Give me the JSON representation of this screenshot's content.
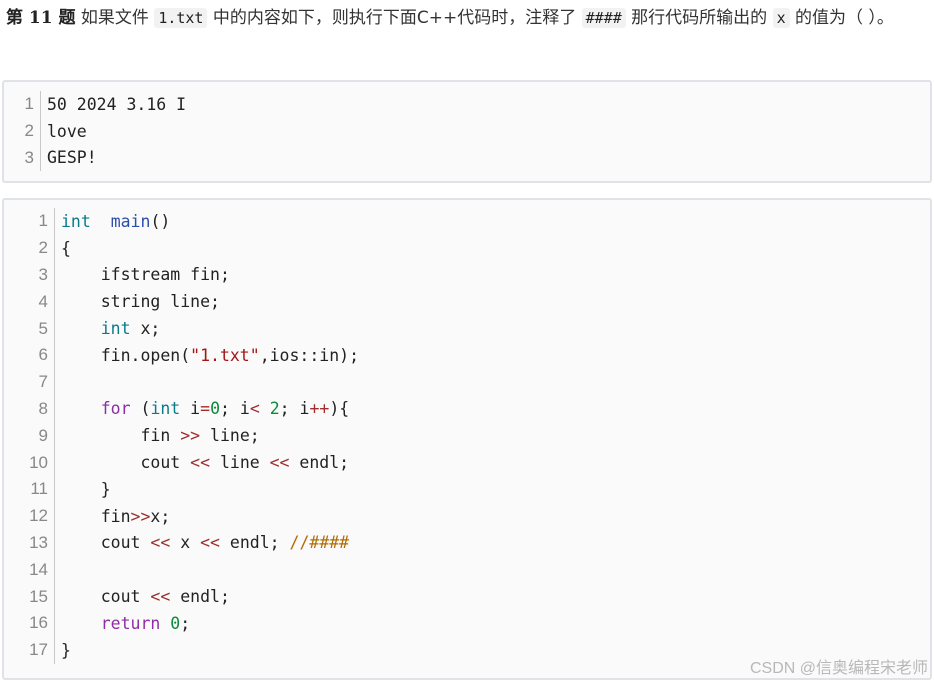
{
  "question": {
    "number_label": "第 11 题",
    "text_before": "如果文件",
    "filename": "1.txt",
    "text_middle": "中的内容如下，则执行下面C++代码时，注释了",
    "marker": "####",
    "text_after": "那行代码所输出的",
    "var": "x",
    "text_end": "的值为（ ）。"
  },
  "file_lines": [
    {
      "n": "1",
      "text": "50 2024 3.16 I"
    },
    {
      "n": "2",
      "text": "love"
    },
    {
      "n": "3",
      "text": "GESP!"
    }
  ],
  "code_lines": [
    {
      "n": "1",
      "tokens": [
        [
          "kw",
          "int"
        ],
        [
          "",
          "  "
        ],
        [
          "fn",
          "main"
        ],
        [
          "",
          "()"
        ]
      ]
    },
    {
      "n": "2",
      "tokens": [
        [
          "",
          "{"
        ]
      ]
    },
    {
      "n": "3",
      "tokens": [
        [
          "",
          "    ifstream fin;"
        ]
      ]
    },
    {
      "n": "4",
      "tokens": [
        [
          "",
          "    string line;"
        ]
      ]
    },
    {
      "n": "5",
      "tokens": [
        [
          "",
          "    "
        ],
        [
          "kw",
          "int"
        ],
        [
          "",
          " x;"
        ]
      ]
    },
    {
      "n": "6",
      "tokens": [
        [
          "",
          "    fin.open("
        ],
        [
          "str",
          "\"1.txt\""
        ],
        [
          "",
          ",ios::in);"
        ]
      ]
    },
    {
      "n": "7",
      "tokens": [
        [
          "",
          ""
        ]
      ]
    },
    {
      "n": "8",
      "tokens": [
        [
          "",
          "    "
        ],
        [
          "ctrl",
          "for"
        ],
        [
          "",
          " ("
        ],
        [
          "kw",
          "int"
        ],
        [
          "",
          " i"
        ],
        [
          "op",
          "="
        ],
        [
          "num",
          "0"
        ],
        [
          "",
          "; i"
        ],
        [
          "op",
          "<"
        ],
        [
          "",
          " "
        ],
        [
          "num",
          "2"
        ],
        [
          "",
          "; i"
        ],
        [
          "op",
          "++"
        ],
        [
          "",
          "){"
        ]
      ]
    },
    {
      "n": "9",
      "tokens": [
        [
          "",
          "        fin "
        ],
        [
          "op",
          ">>"
        ],
        [
          "",
          " line;"
        ]
      ]
    },
    {
      "n": "10",
      "tokens": [
        [
          "",
          "        cout "
        ],
        [
          "op",
          "<<"
        ],
        [
          "",
          " line "
        ],
        [
          "op",
          "<<"
        ],
        [
          "",
          " endl;"
        ]
      ]
    },
    {
      "n": "11",
      "tokens": [
        [
          "",
          "    }"
        ]
      ]
    },
    {
      "n": "12",
      "tokens": [
        [
          "",
          "    fin"
        ],
        [
          "op",
          ">>"
        ],
        [
          "",
          "x;"
        ]
      ]
    },
    {
      "n": "13",
      "tokens": [
        [
          "",
          "    cout "
        ],
        [
          "op",
          "<<"
        ],
        [
          "",
          " x "
        ],
        [
          "op",
          "<<"
        ],
        [
          "",
          " endl; "
        ],
        [
          "cmt",
          "//####"
        ]
      ]
    },
    {
      "n": "14",
      "tokens": [
        [
          "",
          ""
        ]
      ]
    },
    {
      "n": "15",
      "tokens": [
        [
          "",
          "    cout "
        ],
        [
          "op",
          "<<"
        ],
        [
          "",
          " endl;"
        ]
      ]
    },
    {
      "n": "16",
      "tokens": [
        [
          "",
          "    "
        ],
        [
          "ctrl",
          "return"
        ],
        [
          "",
          " "
        ],
        [
          "num",
          "0"
        ],
        [
          "",
          ";"
        ]
      ]
    },
    {
      "n": "17",
      "tokens": [
        [
          "",
          "}"
        ]
      ]
    }
  ],
  "watermark": "CSDN @信奥编程宋老师"
}
